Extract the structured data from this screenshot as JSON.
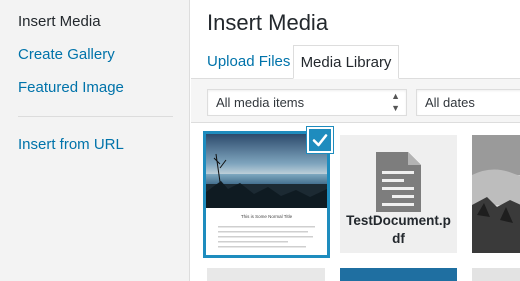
{
  "sidebar": {
    "items": [
      {
        "label": "Insert Media"
      },
      {
        "label": "Create Gallery"
      },
      {
        "label": "Featured Image"
      },
      {
        "label": "Insert from URL"
      }
    ]
  },
  "frame": {
    "title": "Insert Media"
  },
  "tabs": [
    {
      "label": "Upload Files"
    },
    {
      "label": "Media Library"
    }
  ],
  "filters": {
    "media_type": "All media items",
    "date": "All dates"
  },
  "attachments": {
    "selected": {
      "thumbnail_title": "This is Some Normal Title"
    },
    "document": {
      "filename_line1": "TestDocument.p",
      "filename_line2": "df"
    }
  },
  "colors": {
    "accent": "#1e8cbe",
    "link": "#0073aa",
    "sidebar_bg": "#f3f3f3"
  }
}
